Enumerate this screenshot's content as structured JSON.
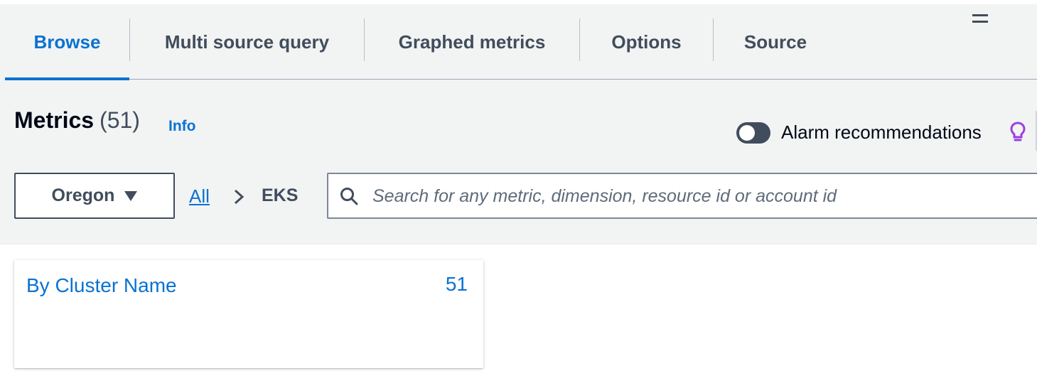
{
  "tabs": [
    {
      "label": "Browse",
      "active": true
    },
    {
      "label": "Multi source query",
      "active": false
    },
    {
      "label": "Graphed metrics",
      "active": false
    },
    {
      "label": "Options",
      "active": false
    },
    {
      "label": "Source",
      "active": false
    }
  ],
  "header": {
    "title": "Metrics",
    "count": "(51)",
    "info_link": "Info",
    "alarm_toggle": {
      "label": "Alarm recommendations",
      "on": false
    },
    "icons": [
      "menu-icon",
      "lightbulb-icon"
    ]
  },
  "controls": {
    "region": {
      "value": "Oregon",
      "icon": "caret-down-icon"
    },
    "breadcrumb": {
      "root": "All",
      "current": "EKS",
      "separator_icon": "chevron-right-icon"
    },
    "search": {
      "value": "",
      "placeholder": "Search for any metric, dimension, resource id or account id",
      "icon": "search-icon"
    }
  },
  "cards": [
    {
      "title": "By Cluster Name",
      "count": "51"
    }
  ],
  "colors": {
    "accent": "#0972d3",
    "text": "#000716",
    "muted": "#414d5c",
    "bulb": "#9a3fe0",
    "panel_bg": "#f2f3f3"
  }
}
